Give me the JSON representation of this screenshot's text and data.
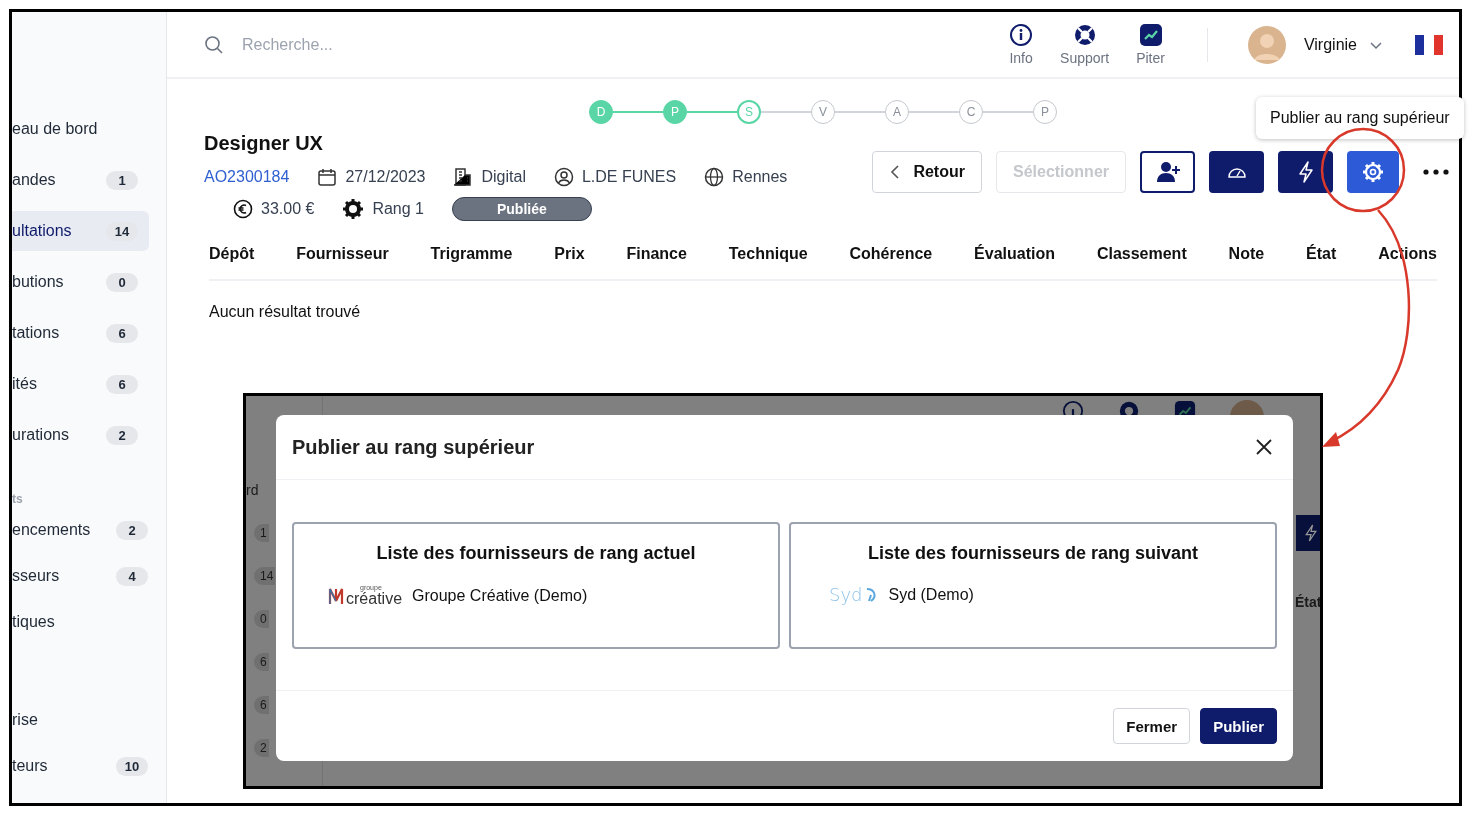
{
  "sidebar": {
    "groups": [
      {
        "items": [
          {
            "label": "eau de bord",
            "selected": false
          },
          {
            "label": "andes",
            "count": "1",
            "selected": false
          },
          {
            "label": "ultations",
            "count": "14",
            "selected": true
          },
          {
            "label": "butions",
            "count": "0",
            "selected": false
          },
          {
            "label": "tations",
            "count": "6",
            "selected": false
          },
          {
            "label": "ités",
            "count": "6",
            "selected": false
          },
          {
            "label": "urations",
            "count": "2",
            "selected": false
          }
        ]
      },
      {
        "heading": "ts",
        "items": [
          {
            "label": "encements",
            "count": "2",
            "selected": false
          },
          {
            "label": "sseurs",
            "count": "4",
            "selected": false
          },
          {
            "label": "tiques",
            "selected": false
          }
        ]
      },
      {
        "items": [
          {
            "label": "rise",
            "selected": false
          },
          {
            "label": "teurs",
            "count": "10",
            "selected": false
          }
        ]
      }
    ]
  },
  "header": {
    "search": {
      "placeholder": "Recherche..."
    },
    "nav": [
      {
        "kind": "info",
        "label": "Info"
      },
      {
        "kind": "support",
        "label": "Support"
      },
      {
        "kind": "piter",
        "label": "Piter"
      }
    ],
    "user": {
      "name": "Virginie"
    }
  },
  "stepper": [
    {
      "letter": "D",
      "done": true,
      "current": false
    },
    {
      "letter": "P",
      "done": true,
      "current": false
    },
    {
      "letter": "S",
      "done": false,
      "current": true
    },
    {
      "letter": "V",
      "done": false,
      "current": false
    },
    {
      "letter": "A",
      "done": false,
      "current": false
    },
    {
      "letter": "C",
      "done": false,
      "current": false
    },
    {
      "letter": "P",
      "done": false,
      "current": false
    }
  ],
  "tender": {
    "title": "Designer UX",
    "meta": [
      {
        "kind": "ref",
        "text": "AO2300184"
      },
      {
        "kind": "date",
        "text": "27/12/2023"
      },
      {
        "kind": "category",
        "text": "Digital"
      },
      {
        "kind": "owner",
        "text": "L.DE FUNES"
      },
      {
        "kind": "city",
        "text": "Rennes"
      }
    ],
    "meta2": [
      {
        "kind": "price",
        "text": "33.00 €"
      },
      {
        "kind": "rank",
        "text": "Rang 1"
      }
    ],
    "status": "Publiée"
  },
  "actions": [
    {
      "kind": "back",
      "label": "Retour"
    },
    {
      "kind": "select",
      "label": "Sélectionner",
      "disabled": true
    },
    {
      "kind": "add-user"
    },
    {
      "kind": "gauge"
    },
    {
      "kind": "bolt"
    },
    {
      "kind": "settings"
    },
    {
      "kind": "more"
    }
  ],
  "tooltip": "Publier au rang supérieur",
  "table": {
    "columns": [
      "Dépôt",
      "Fournisseur",
      "Trigramme",
      "Prix",
      "Finance",
      "Technique",
      "Cohérence",
      "Évaluation",
      "Classement",
      "Note",
      "État",
      "Actions"
    ],
    "empty": "Aucun résultat trouvé"
  },
  "inset": {
    "background": {
      "sidebar_text": "rd",
      "counts": [
        "1",
        "14",
        "0",
        "6",
        "6",
        "2"
      ],
      "column": "État"
    },
    "modal": {
      "title": "Publier au rang supérieur",
      "panels": [
        {
          "title": "Liste des fournisseurs de rang actuel",
          "supplier": {
            "kind": "creative",
            "logo_text": [
              "groupe",
              "créative"
            ],
            "name": "Groupe Créative (Demo)"
          }
        },
        {
          "title": "Liste des fournisseurs de rang suivant",
          "supplier": {
            "kind": "syd",
            "logo_text": [
              "Syd"
            ],
            "name": "Syd (Demo)"
          }
        }
      ],
      "buttons": [
        {
          "kind": "secondary",
          "label": "Fermer"
        },
        {
          "kind": "primary",
          "label": "Publier"
        }
      ]
    }
  }
}
